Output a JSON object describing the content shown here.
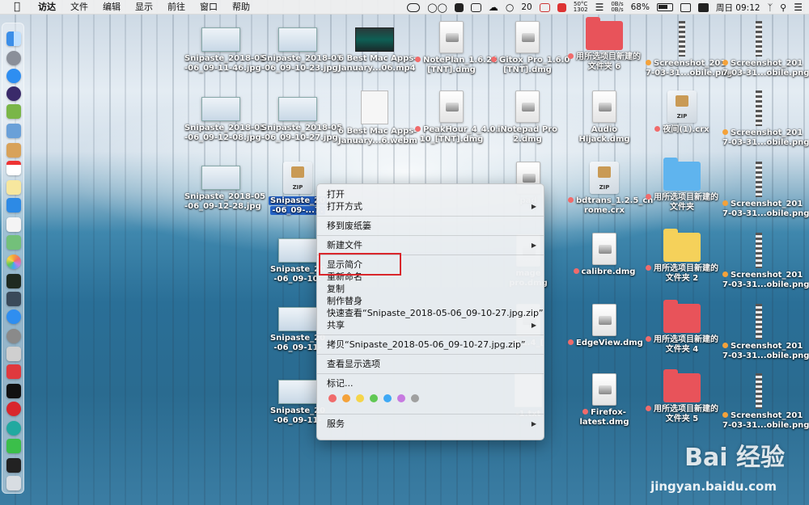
{
  "menubar": {
    "app": "访达",
    "items": [
      "文件",
      "编辑",
      "显示",
      "前往",
      "窗口",
      "帮助"
    ],
    "notifications": "20",
    "cpu_temp": "50°C",
    "fan": "1302",
    "net_up": "0B/s",
    "net_down": "0B/s",
    "battery": "68%",
    "clock": "周日 09:12"
  },
  "desktop": {
    "icons": [
      {
        "name": "Snipaste_2018-05\n-06_09-11-46.jpg",
        "kind": "shot"
      },
      {
        "name": "Snipaste_2018-05\n-06_09-10-23.jpg",
        "kind": "shot"
      },
      {
        "name": "6 Best Mac Apps-\nJanuary...06.mp4",
        "kind": "video"
      },
      {
        "name": "NotePlan_1.6.24\n[TNT].dmg",
        "kind": "dmg",
        "tag": "#f06b6b"
      },
      {
        "name": "Gitox_Pro_1.6.0\n[TNT].dmg",
        "kind": "dmg",
        "tag": "#f06b6b"
      },
      {
        "name": "用所选项目新建的\n文件夹 6",
        "kind": "folder-red",
        "tag": "#f06b6b"
      },
      {
        "name": "Screenshot_201\n7-03-31...obile.png",
        "kind": "strip",
        "tag": "#f4a23a"
      },
      {
        "name": "Screenshot_201\n7-03-31...obile.png",
        "kind": "strip",
        "tag": "#f4a23a"
      },
      {
        "name": "Snipaste_2018-05\n-06_09-12-08.jpg",
        "kind": "shot"
      },
      {
        "name": "Snipaste_2018-05\n-06_09-10-27.jpg",
        "kind": "shot"
      },
      {
        "name": "6 Best Mac Apps-\nJanuary...6.webm",
        "kind": "doc"
      },
      {
        "name": "PeakHour_4_4.0.\n10_[TNT].dmg",
        "kind": "dmg",
        "tag": "#f06b6b"
      },
      {
        "name": "iNotepad Pro\n2.dmg",
        "kind": "dmg"
      },
      {
        "name": "Audio\nHijack.dmg",
        "kind": "dmg"
      },
      {
        "name": "夜间(1).crx",
        "kind": "zip",
        "tag": "#f06b6b"
      },
      {
        "name": "Screenshot_201\n7-03-31...obile.png",
        "kind": "strip",
        "tag": "#f4a23a"
      },
      {
        "name": "Snipaste_2018-05\n-06_09-12-28.jpg",
        "kind": "shot"
      },
      {
        "name": "Snipaste_20\n-06_09-...7.",
        "kind": "zip",
        "selected": true
      },
      {
        "name": "bdtrans_1.2.5_ch\nrome.crx",
        "kind": "zip",
        "tag": "#f06b6b"
      },
      {
        "name": "用所选项目新建的\n文件夹",
        "kind": "folder-blue",
        "tag": "#f06b6b"
      },
      {
        "name": "Screenshot_201\n7-03-31...obile.png",
        "kind": "strip",
        "tag": "#f4a23a"
      },
      {
        "name": "calibre.dmg",
        "kind": "dmg",
        "tag": "#f06b6b"
      },
      {
        "name": "用所选项目新建的\n文件夹 2",
        "kind": "folder-yellow",
        "tag": "#f06b6b"
      },
      {
        "name": "Screenshot_201\n7-03-31...obile.png",
        "kind": "strip",
        "tag": "#f4a23a"
      },
      {
        "name": "EdgeView.dmg",
        "kind": "dmg",
        "tag": "#f06b6b"
      },
      {
        "name": "用所选项目新建的\n文件夹 4",
        "kind": "folder-red",
        "tag": "#f06b6b"
      },
      {
        "name": "Screenshot_201\n7-03-31...obile.png",
        "kind": "strip",
        "tag": "#f4a23a"
      },
      {
        "name": "Firefox-\nlatest.dmg",
        "kind": "dmg",
        "tag": "#f06b6b"
      },
      {
        "name": "用所选项目新建的\n文件夹 5",
        "kind": "folder-red",
        "tag": "#f06b6b"
      },
      {
        "name": "Screenshot_201\n7-03-31...obile.png",
        "kind": "strip",
        "tag": "#f4a23a"
      },
      {
        "name": "Snipaste_20\n-06_09-10-",
        "kind": "shot"
      },
      {
        "name": "Snipaste_20\n-06_09-11-",
        "kind": "shot"
      },
      {
        "name": "Snipaste_20\n-06_09-11-",
        "kind": "shot"
      },
      {
        "name": "pad",
        "kind": "dmg"
      },
      {
        "name": "mage\npro.dmg",
        "kind": "dmg"
      },
      {
        "name": "9.1.4_[",
        "kind": "dmg"
      },
      {
        "name": "-1.txt",
        "kind": "doc"
      }
    ]
  },
  "context_menu": {
    "open": "打开",
    "open_with": "打开方式",
    "move_to_trash": "移到废纸篓",
    "new_folder": "新建文件",
    "get_info": "显示简介",
    "rename": "重新命名",
    "copy": "复制",
    "make_alias": "制作替身",
    "quick_look": "快速查看“Snipaste_2018-05-06_09-10-27.jpg.zip”",
    "share": "共享",
    "copy_item": "拷贝“Snipaste_2018-05-06_09-10-27.jpg.zip”",
    "view_options": "查看显示选项",
    "tags": "标记...",
    "tag_colors": [
      "#f06b6b",
      "#f4a23a",
      "#f5d54a",
      "#61c854",
      "#3fa9f5",
      "#c77ae0",
      "#a0a0a0"
    ],
    "services": "服务"
  },
  "watermark": {
    "brand": "Bai 经验",
    "url": "jingyan.baidu.com"
  }
}
